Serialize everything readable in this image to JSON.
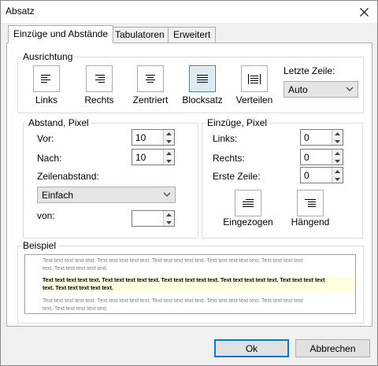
{
  "window": {
    "title": "Absatz"
  },
  "tabs": [
    {
      "label": "Einzüge und Abstände",
      "active": true
    },
    {
      "label": "Tabulatoren",
      "active": false
    },
    {
      "label": "Erweitert",
      "active": false
    }
  ],
  "ausrichtung": {
    "legend": "Ausrichtung",
    "buttons": [
      {
        "label": "Links",
        "icon": "align-left-icon",
        "selected": false
      },
      {
        "label": "Rechts",
        "icon": "align-right-icon",
        "selected": false
      },
      {
        "label": "Zentriert",
        "icon": "align-center-icon",
        "selected": false
      },
      {
        "label": "Blocksatz",
        "icon": "align-justify-icon",
        "selected": true
      },
      {
        "label": "Verteilen",
        "icon": "align-distribute-icon",
        "selected": false
      }
    ],
    "letzte_zeile_label": "Letzte Zeile:",
    "letzte_zeile_value": "Auto"
  },
  "abstand": {
    "legend": "Abstand, Pixel",
    "vor_label": "Vor:",
    "vor_value": "10",
    "nach_label": "Nach:",
    "nach_value": "10",
    "zeilenabstand_label": "Zeilenabstand:",
    "zeilenabstand_value": "Einfach",
    "von_label": "von:",
    "von_value": ""
  },
  "einzuege": {
    "legend": "Einzüge, Pixel",
    "links_label": "Links:",
    "links_value": "0",
    "rechts_label": "Rechts:",
    "rechts_value": "0",
    "erste_zeile_label": "Erste Zeile:",
    "erste_zeile_value": "0",
    "eingezogen_label": "Eingezogen",
    "haengend_label": "Hängend"
  },
  "beispiel": {
    "legend": "Beispiel",
    "gray_text_1a": "Text text text text text. Text text text text text. Text text text text text. Text text text text text. Text text text text",
    "gray_text_1b": "text. Text text text text text.",
    "sample_text_a": "Text text text text text. Text text text text text. Text text text text text. Text text text text text. Text text text text",
    "sample_text_b": "text. Text text text text text.",
    "gray_text_2a": "Text text text text text. Text text text text text. Text text text text text. Text text text text text. Text text text text",
    "gray_text_2b": "text. Text text text text text."
  },
  "footer": {
    "ok_label": "Ok",
    "cancel_label": "Abbrechen"
  },
  "colors": {
    "selected_border": "#3c7fb1",
    "default_button_border": "#0078d7",
    "sample_bg": "#ffffe1"
  }
}
